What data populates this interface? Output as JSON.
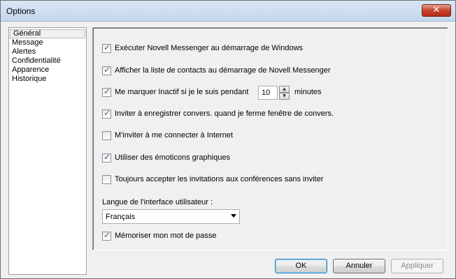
{
  "window": {
    "title": "Options",
    "close_label": "✕"
  },
  "nav": {
    "items": [
      {
        "label": "Général",
        "selected": true
      },
      {
        "label": "Message",
        "selected": false
      },
      {
        "label": "Alertes",
        "selected": false
      },
      {
        "label": "Confidentialité",
        "selected": false
      },
      {
        "label": "Apparence",
        "selected": false
      },
      {
        "label": "Historique",
        "selected": false
      }
    ]
  },
  "general": {
    "options": [
      {
        "label": "Exécuter Novell Messenger au démarrage de Windows",
        "checked": true
      },
      {
        "label": "Afficher la liste de contacts au démarrage de Novell Messenger",
        "checked": true
      },
      {
        "label": "Me marquer Inactif si je le suis pendant",
        "checked": true
      },
      {
        "label": "Inviter à enregistrer convers. quand je ferme fenêtre de convers.",
        "checked": true
      },
      {
        "label": "M'inviter à me connecter à Internet",
        "checked": false
      },
      {
        "label": "Utiliser des émoticons graphiques",
        "checked": true
      },
      {
        "label": "Toujours accepter les invitations aux conférences sans inviter",
        "checked": false
      }
    ],
    "idle_minutes": "10",
    "idle_suffix": "minutes",
    "language_label": "Langue de l'interface utilisateur :",
    "language_value": "Français",
    "remember_password": {
      "label": "Mémoriser mon mot de passe",
      "checked": true
    }
  },
  "buttons": {
    "ok": "OK",
    "cancel": "Annuler",
    "apply": "Appliquer"
  },
  "check_glyph": "✓",
  "spin_up_glyph": "▲",
  "spin_down_glyph": "▼"
}
